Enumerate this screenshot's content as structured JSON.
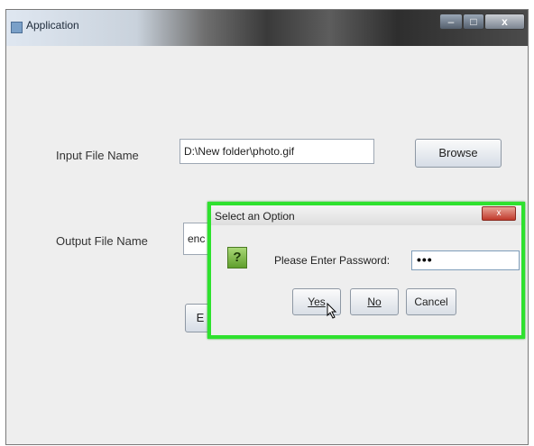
{
  "window": {
    "title": "Application",
    "controls": {
      "minimize": "–",
      "maximize": "□",
      "close": "x"
    }
  },
  "form": {
    "input_label": "Input File Name",
    "input_value": "D:\\New folder\\photo.gif",
    "browse_label": "Browse",
    "output_label": "Output File Name",
    "output_value": "enc",
    "hidden_button_label": "E"
  },
  "dialog": {
    "title": "Select an Option",
    "close": "x",
    "question_icon": "?",
    "prompt": "Please Enter Password:",
    "password_mask": "•••",
    "buttons": {
      "yes": "Yes",
      "no": "No",
      "cancel": "Cancel"
    }
  },
  "colors": {
    "dialog_highlight": "#2ee12e",
    "question_icon": "#7fbf47"
  },
  "icons": {
    "app": "java-app-icon",
    "question": "question-icon",
    "cursor": "mouse-pointer-icon"
  }
}
